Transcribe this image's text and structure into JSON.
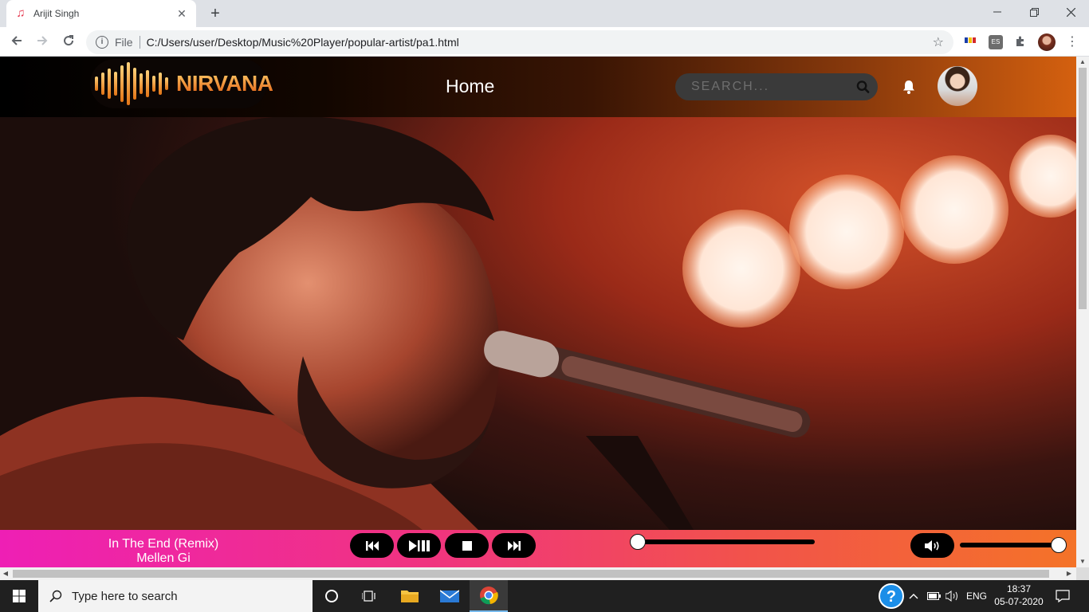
{
  "browser": {
    "tab_title": "Arijit Singh",
    "url_scheme": "File",
    "url": "C:/Users/user/Desktop/Music%20Player/popular-artist/pa1.html"
  },
  "site": {
    "logo_text": "NIRVANA",
    "nav_home": "Home",
    "search_placeholder": "SEARCH..."
  },
  "player": {
    "song_title": "In The End (Remix)",
    "song_artist": "Mellen Gi",
    "seek_position": 0.0,
    "volume": 1.0
  },
  "taskbar": {
    "search_placeholder": "Type here to search",
    "language": "ENG",
    "time": "18:37",
    "date": "05-07-2020"
  },
  "colors": {
    "player_gradient_start": "#ee1fb5",
    "player_gradient_end": "#f47328",
    "header_accent": "#d4600f"
  }
}
